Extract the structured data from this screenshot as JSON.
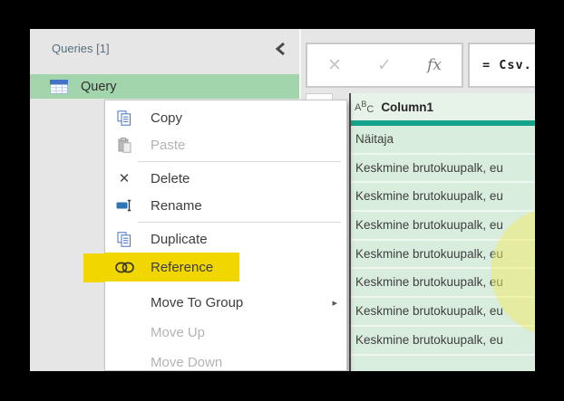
{
  "queries_pane": {
    "header": "Queries [1]",
    "collapse_icon": "chevron-left-icon",
    "items": [
      {
        "label": "Query",
        "selected": true,
        "icon": "table-icon"
      }
    ]
  },
  "formula_bar": {
    "cancel_glyph": "✕",
    "check_glyph": "✓",
    "fx_label": "fx",
    "formula_text": "= Csv."
  },
  "context_menu": {
    "items": [
      {
        "label": "Copy",
        "icon": "copy-icon",
        "enabled": true
      },
      {
        "label": "Paste",
        "icon": "paste-icon",
        "enabled": false
      },
      {
        "separator": true
      },
      {
        "label": "Delete",
        "icon": "delete-icon",
        "enabled": true
      },
      {
        "label": "Rename",
        "icon": "rename-icon",
        "enabled": true
      },
      {
        "separator": true
      },
      {
        "label": "Duplicate",
        "icon": "copy-icon",
        "enabled": true
      },
      {
        "label": "Reference",
        "icon": "link-icon",
        "enabled": true,
        "highlighted": true
      },
      {
        "label": "Move To Group",
        "icon": null,
        "enabled": true,
        "submenu": true
      },
      {
        "label": "Move Up",
        "icon": null,
        "enabled": false
      },
      {
        "label": "Move Down",
        "icon": null,
        "enabled": false
      }
    ]
  },
  "data_table": {
    "column_type": "ABC",
    "column_header": "Column1",
    "rows": [
      "Näitaja",
      "Keskmine brutokuupalk, eu",
      "Keskmine brutokuupalk, eu",
      "Keskmine brutokuupalk, eu",
      "Keskmine brutokuupalk, eu",
      "Keskmine brutokuupalk, eu",
      "Keskmine brutokuupalk, eu",
      "Keskmine brutokuupalk, eu",
      ""
    ]
  },
  "colors": {
    "selection_green": "#a3d5ad",
    "table_green": "#d9edde",
    "header_underline_teal": "#16a38b",
    "annotation_yellow": "#f2d600"
  }
}
